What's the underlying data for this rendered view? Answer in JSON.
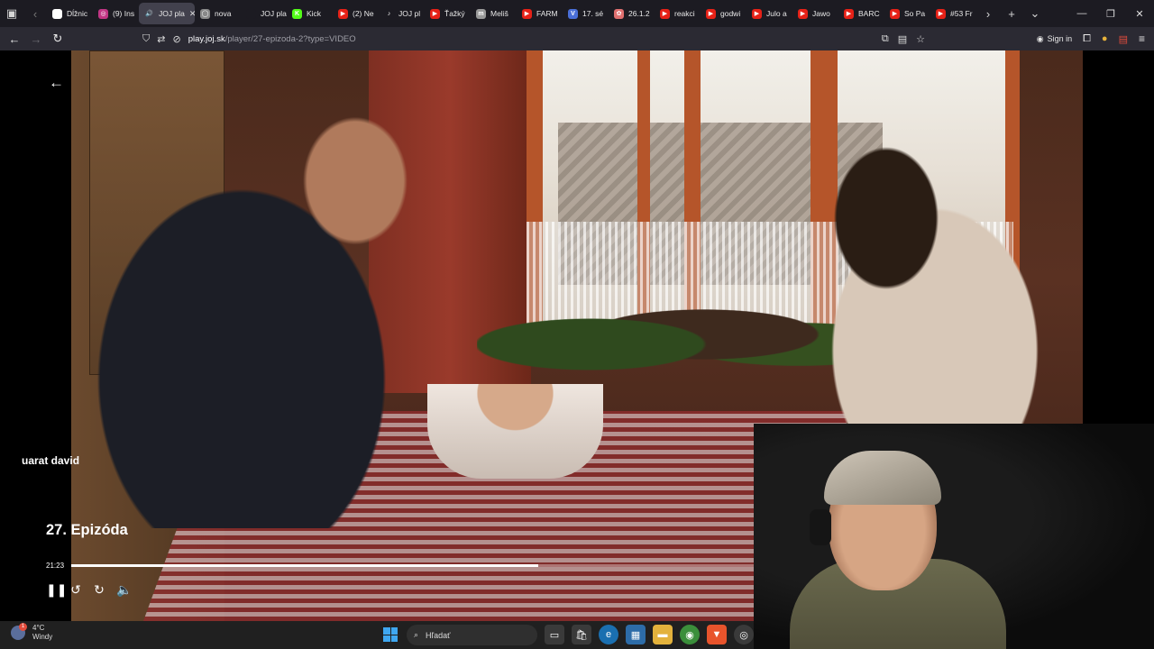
{
  "browser": {
    "tabs": [
      {
        "label": "Dĺžnic",
        "favicon_color": "#ffffff",
        "favicon_text": "d"
      },
      {
        "label": "(9) Ins",
        "favicon_color": "#c13584",
        "favicon_text": "◎"
      },
      {
        "label": "JOJ pla",
        "favicon_color": "#42414d",
        "favicon_text": "🔊",
        "active": true
      },
      {
        "label": "nova",
        "favicon_color": "#888888",
        "favicon_text": "◯"
      },
      {
        "label": "JOJ play",
        "favicon_color": "#1c1b22",
        "favicon_text": ""
      },
      {
        "label": "Kick",
        "favicon_color": "#53fc18",
        "favicon_text": "K"
      },
      {
        "label": "(2) Ne",
        "favicon_color": "#e62117",
        "favicon_text": "▶"
      },
      {
        "label": "JOJ pl",
        "favicon_color": "#1c1b22",
        "favicon_text": "♪"
      },
      {
        "label": "Ťažký",
        "favicon_color": "#e62117",
        "favicon_text": "▶"
      },
      {
        "label": "Meliš",
        "favicon_color": "#999999",
        "favicon_text": "m"
      },
      {
        "label": "FARM",
        "favicon_color": "#e62117",
        "favicon_text": "▶"
      },
      {
        "label": "17. sé",
        "favicon_color": "#4a6fd8",
        "favicon_text": "V"
      },
      {
        "label": "26.1.2",
        "favicon_color": "#e07070",
        "favicon_text": "✿"
      },
      {
        "label": "reakci",
        "favicon_color": "#e62117",
        "favicon_text": "▶"
      },
      {
        "label": "godwi",
        "favicon_color": "#e62117",
        "favicon_text": "▶"
      },
      {
        "label": "Julo a",
        "favicon_color": "#e62117",
        "favicon_text": "▶"
      },
      {
        "label": "Jawo",
        "favicon_color": "#e62117",
        "favicon_text": "▶"
      },
      {
        "label": "BARC",
        "favicon_color": "#e62117",
        "favicon_text": "▶"
      },
      {
        "label": "So Pa",
        "favicon_color": "#e62117",
        "favicon_text": "▶"
      },
      {
        "label": "#53 Fr",
        "favicon_color": "#e62117",
        "favicon_text": "▶"
      }
    ],
    "url_host": "play.joj.sk",
    "url_path": "/player/27-epizoda-2?type=VIDEO",
    "signin_label": "Sign in"
  },
  "player": {
    "watermark_text": "uarat david",
    "episode_title": "27. Epizóda",
    "current_time": "21:23",
    "progress_fraction": 0.462
  },
  "taskbar": {
    "weather_temp": "4°C",
    "weather_desc": "Windy",
    "weather_badge": "1",
    "search_placeholder": "Hľadať"
  }
}
